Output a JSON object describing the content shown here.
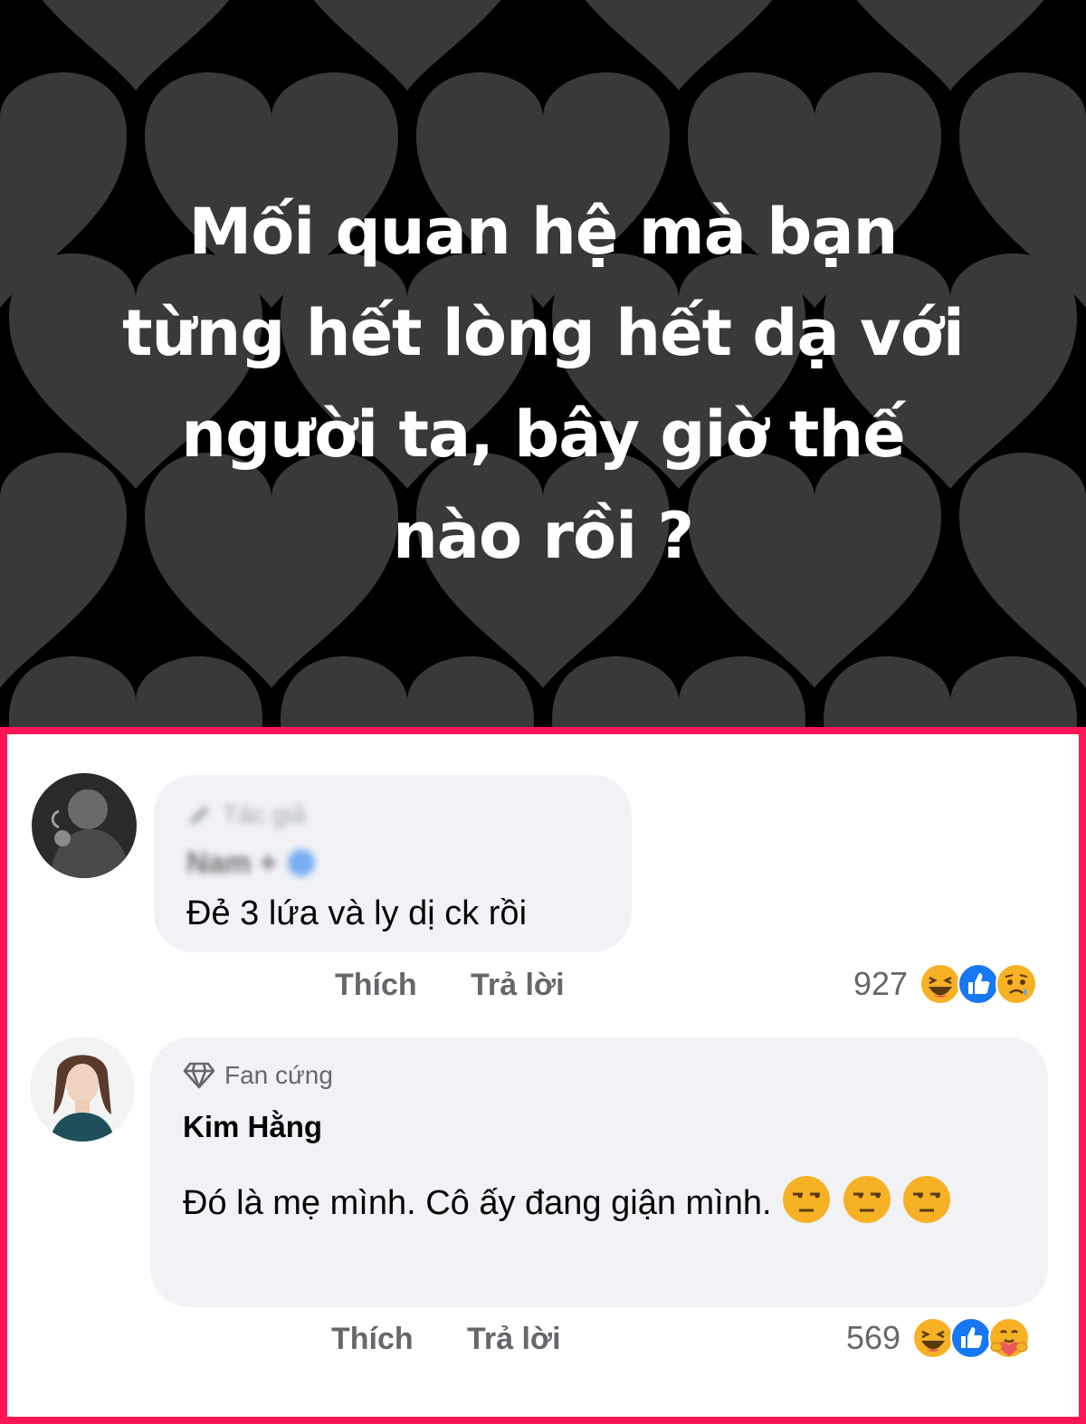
{
  "post": {
    "text_lines": [
      "Mối quan hệ mà bạn",
      "từng hết lòng hết dạ với",
      "người ta, bây giờ thế",
      "nào rồi ?"
    ]
  },
  "comments": [
    {
      "badge_icon": "pencil-icon",
      "badge": "Tác giả",
      "author": "Nam +",
      "text": "Đẻ 3 lứa và ly dị ck rồi",
      "like_label": "Thích",
      "reply_label": "Trả lời",
      "reaction_count": "927",
      "reaction_icons": [
        "haha-reaction-icon",
        "like-reaction-icon",
        "sad-reaction-icon"
      ]
    },
    {
      "badge_icon": "diamond-icon",
      "badge": "Fan cứng",
      "author": "Kim Hằng",
      "text": "Đó là mẹ mình. Cô ấy đang giận mình.",
      "trailing_emoji": [
        "unamused-emoji",
        "unamused-emoji",
        "unamused-emoji"
      ],
      "like_label": "Thích",
      "reply_label": "Trả lời",
      "reaction_count": "569",
      "reaction_icons": [
        "haha-reaction-icon",
        "like-reaction-icon",
        "care-reaction-icon"
      ]
    }
  ],
  "colors": {
    "frame_border": "#ff1456",
    "bubble_bg": "#f0f2f5",
    "muted_text": "#65676b",
    "like_blue": "#1877f2",
    "heart_gray": "#3a3a3a"
  }
}
